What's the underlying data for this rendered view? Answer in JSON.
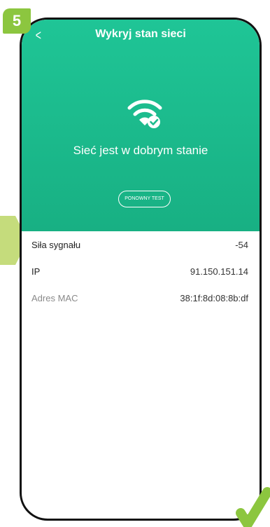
{
  "step": "5",
  "header": {
    "title": "Wykryj stan sieci",
    "back_icon": "chevron-left-icon",
    "status_text": "Sieć jest w dobrym stanie",
    "wifi_icon": "wifi-ok-icon",
    "retest_label": "PONOWNY TEST",
    "color": "#1cbc8d"
  },
  "info": {
    "rows": [
      {
        "label": "Siła sygnału",
        "value": "-54"
      },
      {
        "label": "IP",
        "value": "91.150.151.14"
      },
      {
        "label": "Adres MAC",
        "value": "38:1f:8d:08:8b:df"
      }
    ]
  },
  "accent": "#8cc63f"
}
